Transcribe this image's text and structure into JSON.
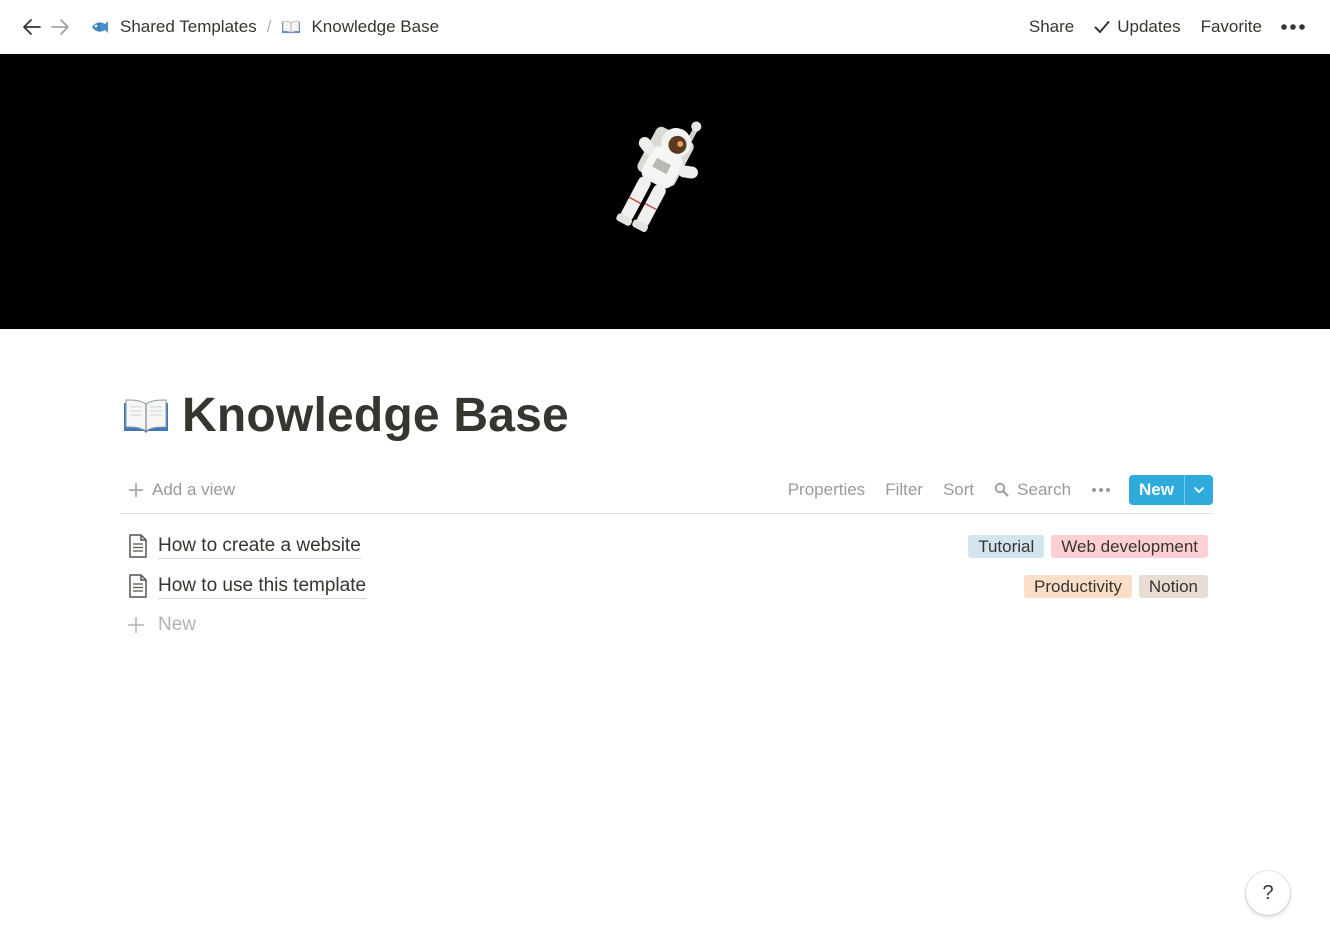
{
  "topbar": {
    "breadcrumbs": [
      {
        "label": "Shared Templates",
        "icon": "fish-icon"
      },
      {
        "label": "Knowledge Base",
        "icon": "open-book-icon"
      }
    ],
    "separator": "/",
    "share_label": "Share",
    "updates_label": "Updates",
    "favorite_label": "Favorite"
  },
  "page": {
    "title": "Knowledge Base",
    "icon": "open-book-icon"
  },
  "viewbar": {
    "add_view_label": "Add a view",
    "properties_label": "Properties",
    "filter_label": "Filter",
    "sort_label": "Sort",
    "search_label": "Search",
    "new_label": "New"
  },
  "rows": [
    {
      "title": "How to create a website",
      "tags": [
        {
          "label": "Tutorial",
          "color": "#d3e5ef"
        },
        {
          "label": "Web development",
          "color": "#ffcfd6"
        }
      ]
    },
    {
      "title": "How to use this template",
      "tags": [
        {
          "label": "Productivity",
          "color": "#fadec9"
        },
        {
          "label": "Notion",
          "color": "#e8ddd4"
        }
      ]
    }
  ],
  "add_row_label": "New",
  "help_label": "?",
  "colors": {
    "accent": "#2eaadc",
    "text": "#37352f",
    "muted": "#9b9a97"
  }
}
